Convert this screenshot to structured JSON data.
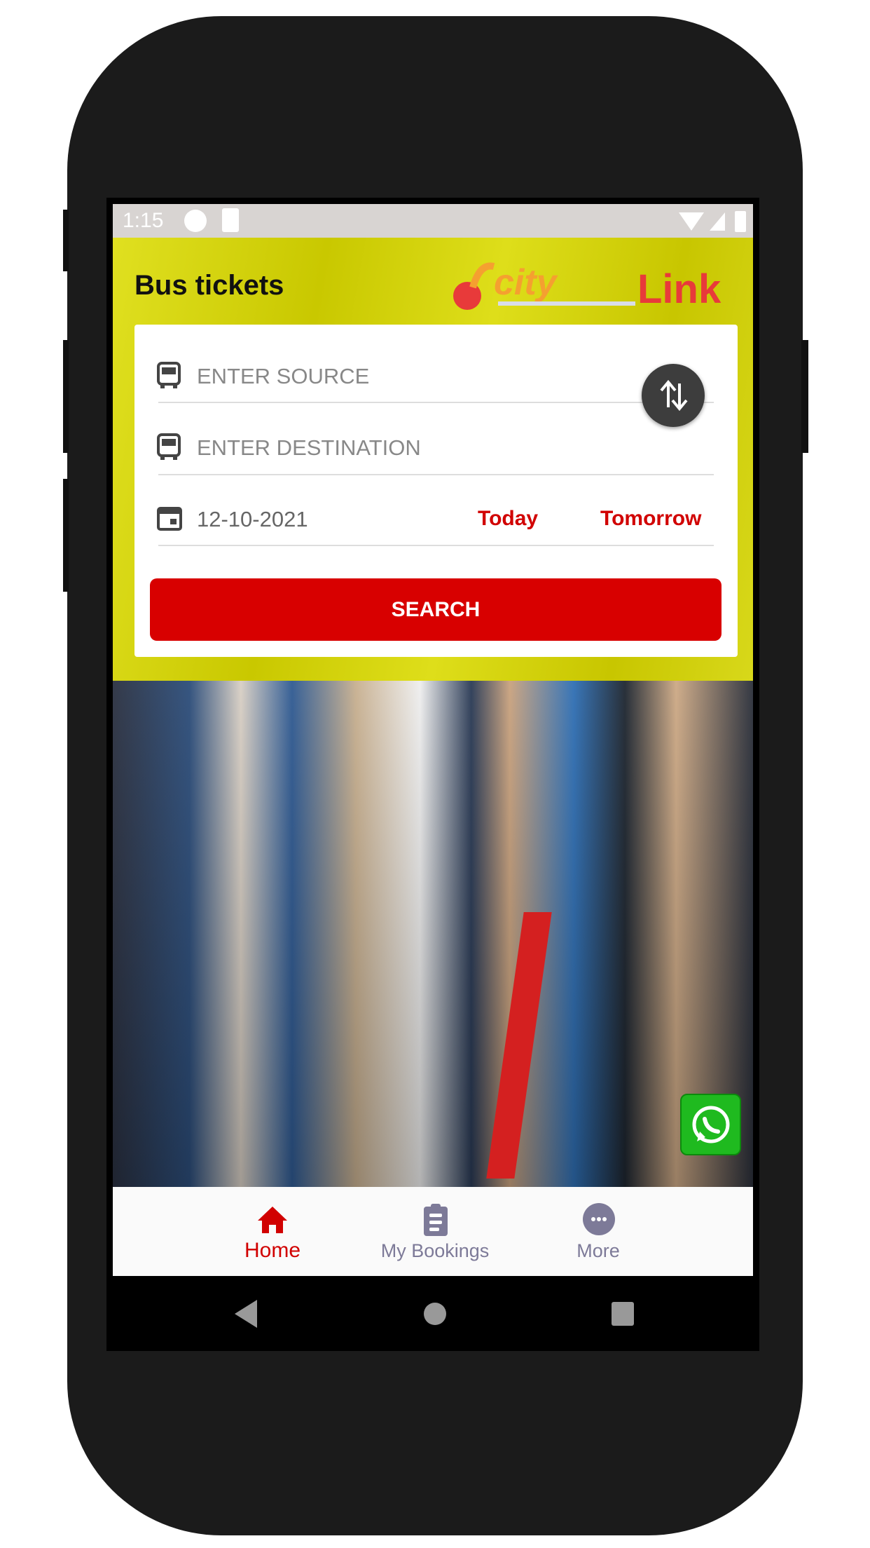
{
  "status_bar": {
    "time": "1:15"
  },
  "header": {
    "title": "Bus tickets",
    "logo_text": "CityLink"
  },
  "search_form": {
    "source_placeholder": "ENTER SOURCE",
    "destination_placeholder": "ENTER DESTINATION",
    "date_value": "12-10-2021",
    "today_label": "Today",
    "tomorrow_label": "Tomorrow",
    "search_label": "SEARCH"
  },
  "bottom_nav": {
    "items": [
      {
        "label": "Home",
        "icon": "home-icon",
        "active": true
      },
      {
        "label": "My Bookings",
        "icon": "clipboard-icon",
        "active": false
      },
      {
        "label": "More",
        "icon": "more-icon",
        "active": false
      }
    ]
  },
  "colors": {
    "accent": "#d80000",
    "header_yellow": "#cfcd0a",
    "nav_inactive": "#7d7a98",
    "whatsapp": "#1fba1f"
  }
}
